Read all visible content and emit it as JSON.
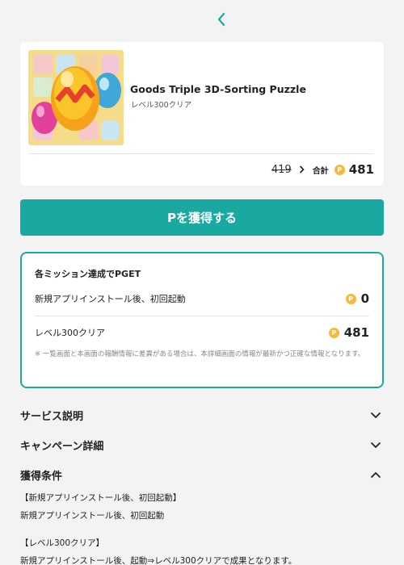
{
  "product": {
    "title": "Goods Triple 3D-Sorting Puzzle",
    "subtitle": "レベル300クリア",
    "old_points": "419",
    "total_label": "合計",
    "total_points": "481"
  },
  "coin_glyph": "P",
  "get_button_label": "Pを獲得する",
  "missions": {
    "title": "各ミッション達成でPGET",
    "items": [
      {
        "label": "新規アプリインストール後、初回起動",
        "points": "0"
      },
      {
        "label": "レベル300クリア",
        "points": "481"
      }
    ],
    "note": "※ 一覧画面と本画面の報酬情報に差異がある場合は、本詳細画面の情報が最新かつ正確な情報となります。"
  },
  "accordions": [
    {
      "label": "サービス説明",
      "state": "collapsed"
    },
    {
      "label": "キャンペーン詳細",
      "state": "collapsed"
    },
    {
      "label": "獲得条件",
      "state": "expanded"
    }
  ],
  "conditions": [
    {
      "heading": "【新規アプリインストール後、初回起動】",
      "body": "新規アプリインストール後、初回起動"
    },
    {
      "heading": "【レベル300クリア】",
      "body": "新規アプリインストール後、起動⇒レベル300クリアで成果となります。"
    }
  ],
  "colors": {
    "accent": "#1aa9a1",
    "coin": "#f6b93b",
    "background": "#f3f3f3"
  }
}
